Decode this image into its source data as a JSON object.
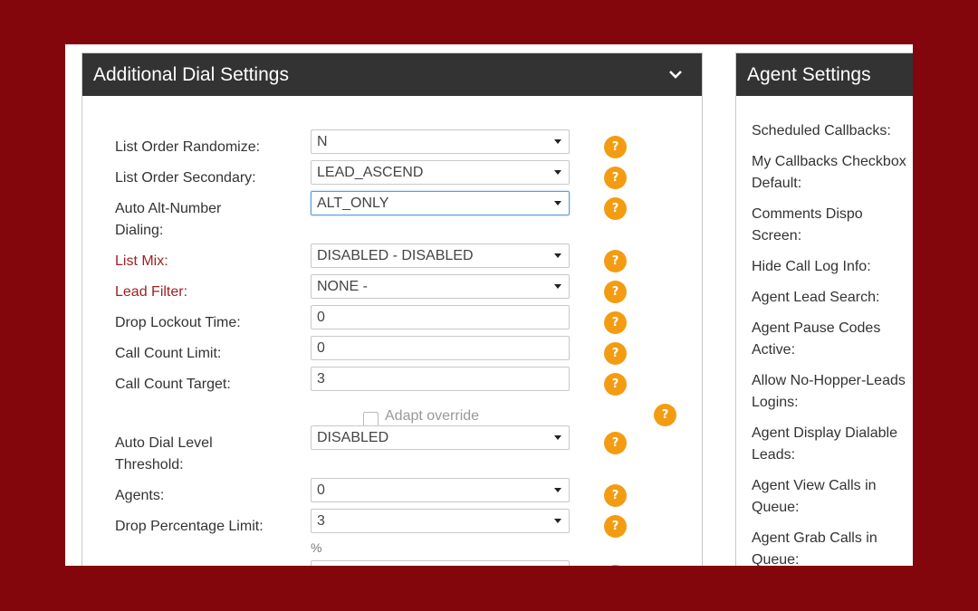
{
  "left_panel": {
    "title": "Additional Dial Settings",
    "rows": [
      {
        "label": "List Order Randomize:",
        "value": "N"
      },
      {
        "label": "List Order Secondary:",
        "value": "LEAD_ASCEND"
      },
      {
        "label_line1": "Auto Alt-Number",
        "label_line2": "Dialing:",
        "value": "ALT_ONLY"
      },
      {
        "label": "List Mix:",
        "value": "DISABLED - DISABLED"
      },
      {
        "label": "Lead Filter:",
        "value": "NONE -"
      },
      {
        "label": "Drop Lockout Time:",
        "value": "0"
      },
      {
        "label": "Call Count Limit:",
        "value": "0"
      },
      {
        "label": "Call Count Target:",
        "value": "3"
      },
      {
        "label_line1": "Auto Dial Level",
        "label_line2": "Threshold:",
        "value": "DISABLED"
      },
      {
        "label": "Agents:",
        "value": "0"
      },
      {
        "label": "Drop Percentage Limit:",
        "value": "3"
      }
    ],
    "adapt_override_label": "Adapt override",
    "percent_unit": "%",
    "help_glyph": "?"
  },
  "right_panel": {
    "title": "Agent Settings",
    "items": [
      {
        "line1": "Scheduled Callbacks:",
        "line2": ""
      },
      {
        "line1": "My Callbacks Checkbox",
        "line2": "Default:"
      },
      {
        "line1": "Comments Dispo",
        "line2": "Screen:"
      },
      {
        "line1": "Hide Call Log Info:",
        "line2": ""
      },
      {
        "line1": "Agent Lead Search:",
        "line2": ""
      },
      {
        "line1": "Agent Pause Codes",
        "line2": "Active:"
      },
      {
        "line1": "Allow No-Hopper-Leads",
        "line2": "Logins:"
      },
      {
        "line1": "Agent Display Dialable",
        "line2": "Leads:"
      },
      {
        "line1": "Agent View Calls in",
        "line2": "Queue:"
      },
      {
        "line1": "Agent Grab Calls in",
        "line2": "Queue:"
      }
    ]
  },
  "colors": {
    "background": "#82060b",
    "header": "#333333",
    "help_icon": "#f39c12",
    "link_label": "#9b2226"
  }
}
